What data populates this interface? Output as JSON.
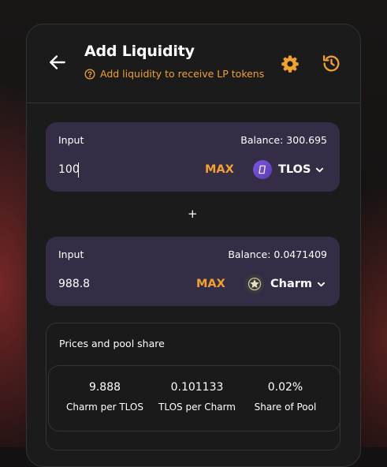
{
  "header": {
    "title": "Add Liquidity",
    "subtitle": "Add liquidity to receive LP tokens"
  },
  "input_a": {
    "label": "Input",
    "balance": "Balance: 300.695",
    "value": "100",
    "max_label": "MAX",
    "token": "TLOS"
  },
  "separator": "+",
  "input_b": {
    "label": "Input",
    "balance": "Balance: 0.0471409",
    "value": "988.8",
    "max_label": "MAX",
    "token": "Charm"
  },
  "prices": {
    "title": "Prices and pool share",
    "stats": [
      {
        "value": "9.888",
        "label": "Charm per TLOS"
      },
      {
        "value": "0.101133",
        "label": "TLOS per Charm"
      },
      {
        "value": "0.02%",
        "label": "Share of Pool"
      }
    ]
  },
  "colors": {
    "accent": "#f2a12c",
    "card": "#1b1b1c",
    "input_panel": "#352d46"
  }
}
